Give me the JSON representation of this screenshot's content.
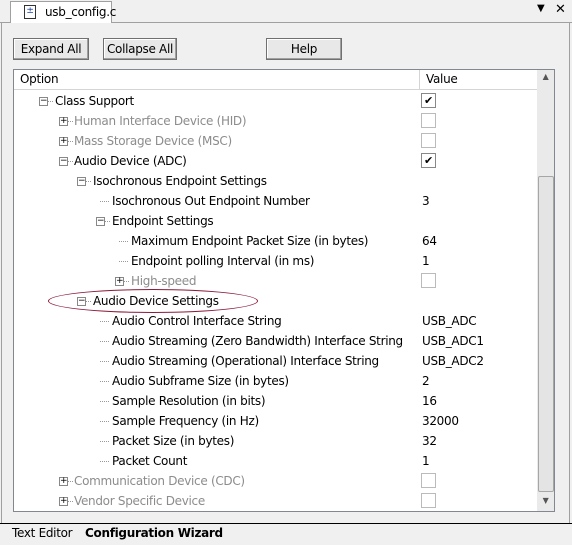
{
  "window": {
    "file_tab": "usb_config.c",
    "dropdown_icon": "triangle-down-icon",
    "close_icon": "close-icon"
  },
  "toolbar": {
    "expand_all": "Expand All",
    "collapse_all": "Collapse All",
    "help": "Help"
  },
  "grid": {
    "columns": {
      "option": "Option",
      "value": "Value"
    },
    "rows": [
      {
        "label": "Class Support",
        "level": 0,
        "expander": "minus",
        "value": {
          "checkbox": true
        }
      },
      {
        "label": "Human Interface Device (HID)",
        "level": 1,
        "expander": "plus",
        "disabled": true,
        "value": {
          "checkbox": false
        }
      },
      {
        "label": "Mass Storage Device (MSC)",
        "level": 1,
        "expander": "plus",
        "disabled": true,
        "value": {
          "checkbox": false
        }
      },
      {
        "label": "Audio Device (ADC)",
        "level": 1,
        "expander": "minus",
        "value": {
          "checkbox": true
        }
      },
      {
        "label": "Isochronous Endpoint Settings",
        "level": 2,
        "expander": "minus"
      },
      {
        "label": "Isochronous Out Endpoint Number",
        "level": 3,
        "value": {
          "text": "3"
        }
      },
      {
        "label": "Endpoint Settings",
        "level": 3,
        "expander": "minus"
      },
      {
        "label": "Maximum Endpoint Packet Size (in bytes)",
        "level": 4,
        "value": {
          "text": "64"
        }
      },
      {
        "label": "Endpoint polling Interval (in ms)",
        "level": 4,
        "value": {
          "text": "1"
        }
      },
      {
        "label": "High-speed",
        "level": 4,
        "expander": "plus",
        "disabled": true,
        "value": {
          "checkbox": false
        }
      },
      {
        "label": "Audio Device Settings",
        "level": 2,
        "expander": "minus",
        "highlighted": true
      },
      {
        "label": "Audio Control Interface String",
        "level": 3,
        "value": {
          "text": "USB_ADC"
        }
      },
      {
        "label": "Audio Streaming (Zero Bandwidth) Interface String",
        "level": 3,
        "value": {
          "text": "USB_ADC1"
        }
      },
      {
        "label": "Audio Streaming (Operational) Interface String",
        "level": 3,
        "value": {
          "text": "USB_ADC2"
        }
      },
      {
        "label": "Audio Subframe Size (in bytes)",
        "level": 3,
        "value": {
          "text": "2"
        }
      },
      {
        "label": "Sample Resolution (in bits)",
        "level": 3,
        "value": {
          "text": "16"
        }
      },
      {
        "label": "Sample Frequency (in Hz)",
        "level": 3,
        "value": {
          "text": "32000"
        }
      },
      {
        "label": "Packet Size (in bytes)",
        "level": 3,
        "value": {
          "text": "32"
        }
      },
      {
        "label": "Packet Count",
        "level": 3,
        "value": {
          "text": "1"
        }
      },
      {
        "label": "Communication Device (CDC)",
        "level": 1,
        "expander": "plus",
        "disabled": true,
        "value": {
          "checkbox": false
        }
      },
      {
        "label": "Vendor Specific Device",
        "level": 1,
        "expander": "plus",
        "disabled": true,
        "value": {
          "checkbox": false
        }
      }
    ]
  },
  "highlight_color": "#8b1a3a",
  "bottom_tabs": [
    {
      "label": "Text Editor",
      "active": false
    },
    {
      "label": "Configuration Wizard",
      "active": true
    }
  ]
}
